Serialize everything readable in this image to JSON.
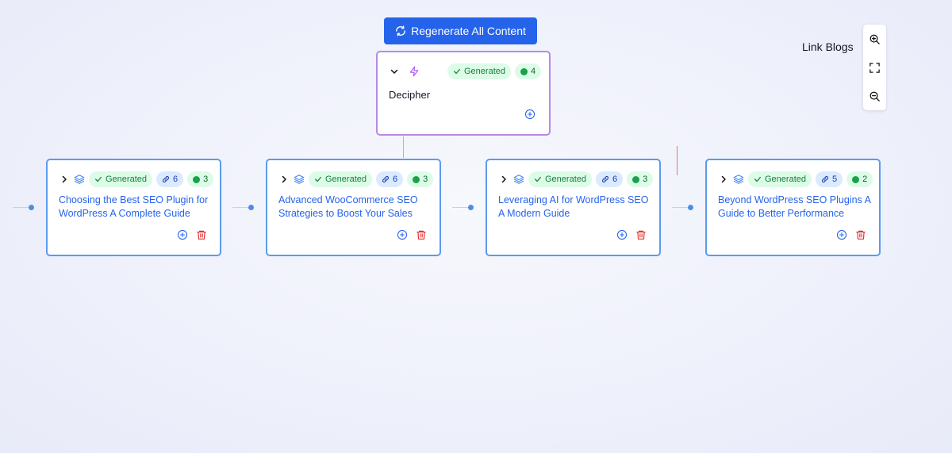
{
  "toolbar": {
    "regenerate_label": "Regenerate All Content",
    "link_blogs_label": "Link Blogs"
  },
  "icons": {
    "regenerate": "refresh-icon",
    "zoom_in": "zoom-in-icon",
    "fit": "fit-screen-icon",
    "zoom_out": "zoom-out-icon"
  },
  "colors": {
    "accent": "#2563eb",
    "root_border": "#b88ae6",
    "child_border": "#5b9bec",
    "generated_bg": "#dcfce7",
    "delete": "#dc2626"
  },
  "root": {
    "title": "Decipher",
    "status": "Generated",
    "count": "4"
  },
  "children": [
    {
      "title": "Choosing the Best SEO Plugin for WordPress A Complete Guide",
      "status": "Generated",
      "links": "6",
      "count": "3"
    },
    {
      "title": "Advanced WooCommerce SEO Strategies to Boost Your Sales",
      "status": "Generated",
      "links": "6",
      "count": "3"
    },
    {
      "title": "Leveraging AI for WordPress SEO A Modern Guide",
      "status": "Generated",
      "links": "6",
      "count": "3"
    },
    {
      "title": "Beyond WordPress SEO Plugins A Guide to Better Performance",
      "status": "Generated",
      "links": "5",
      "count": "2"
    }
  ]
}
